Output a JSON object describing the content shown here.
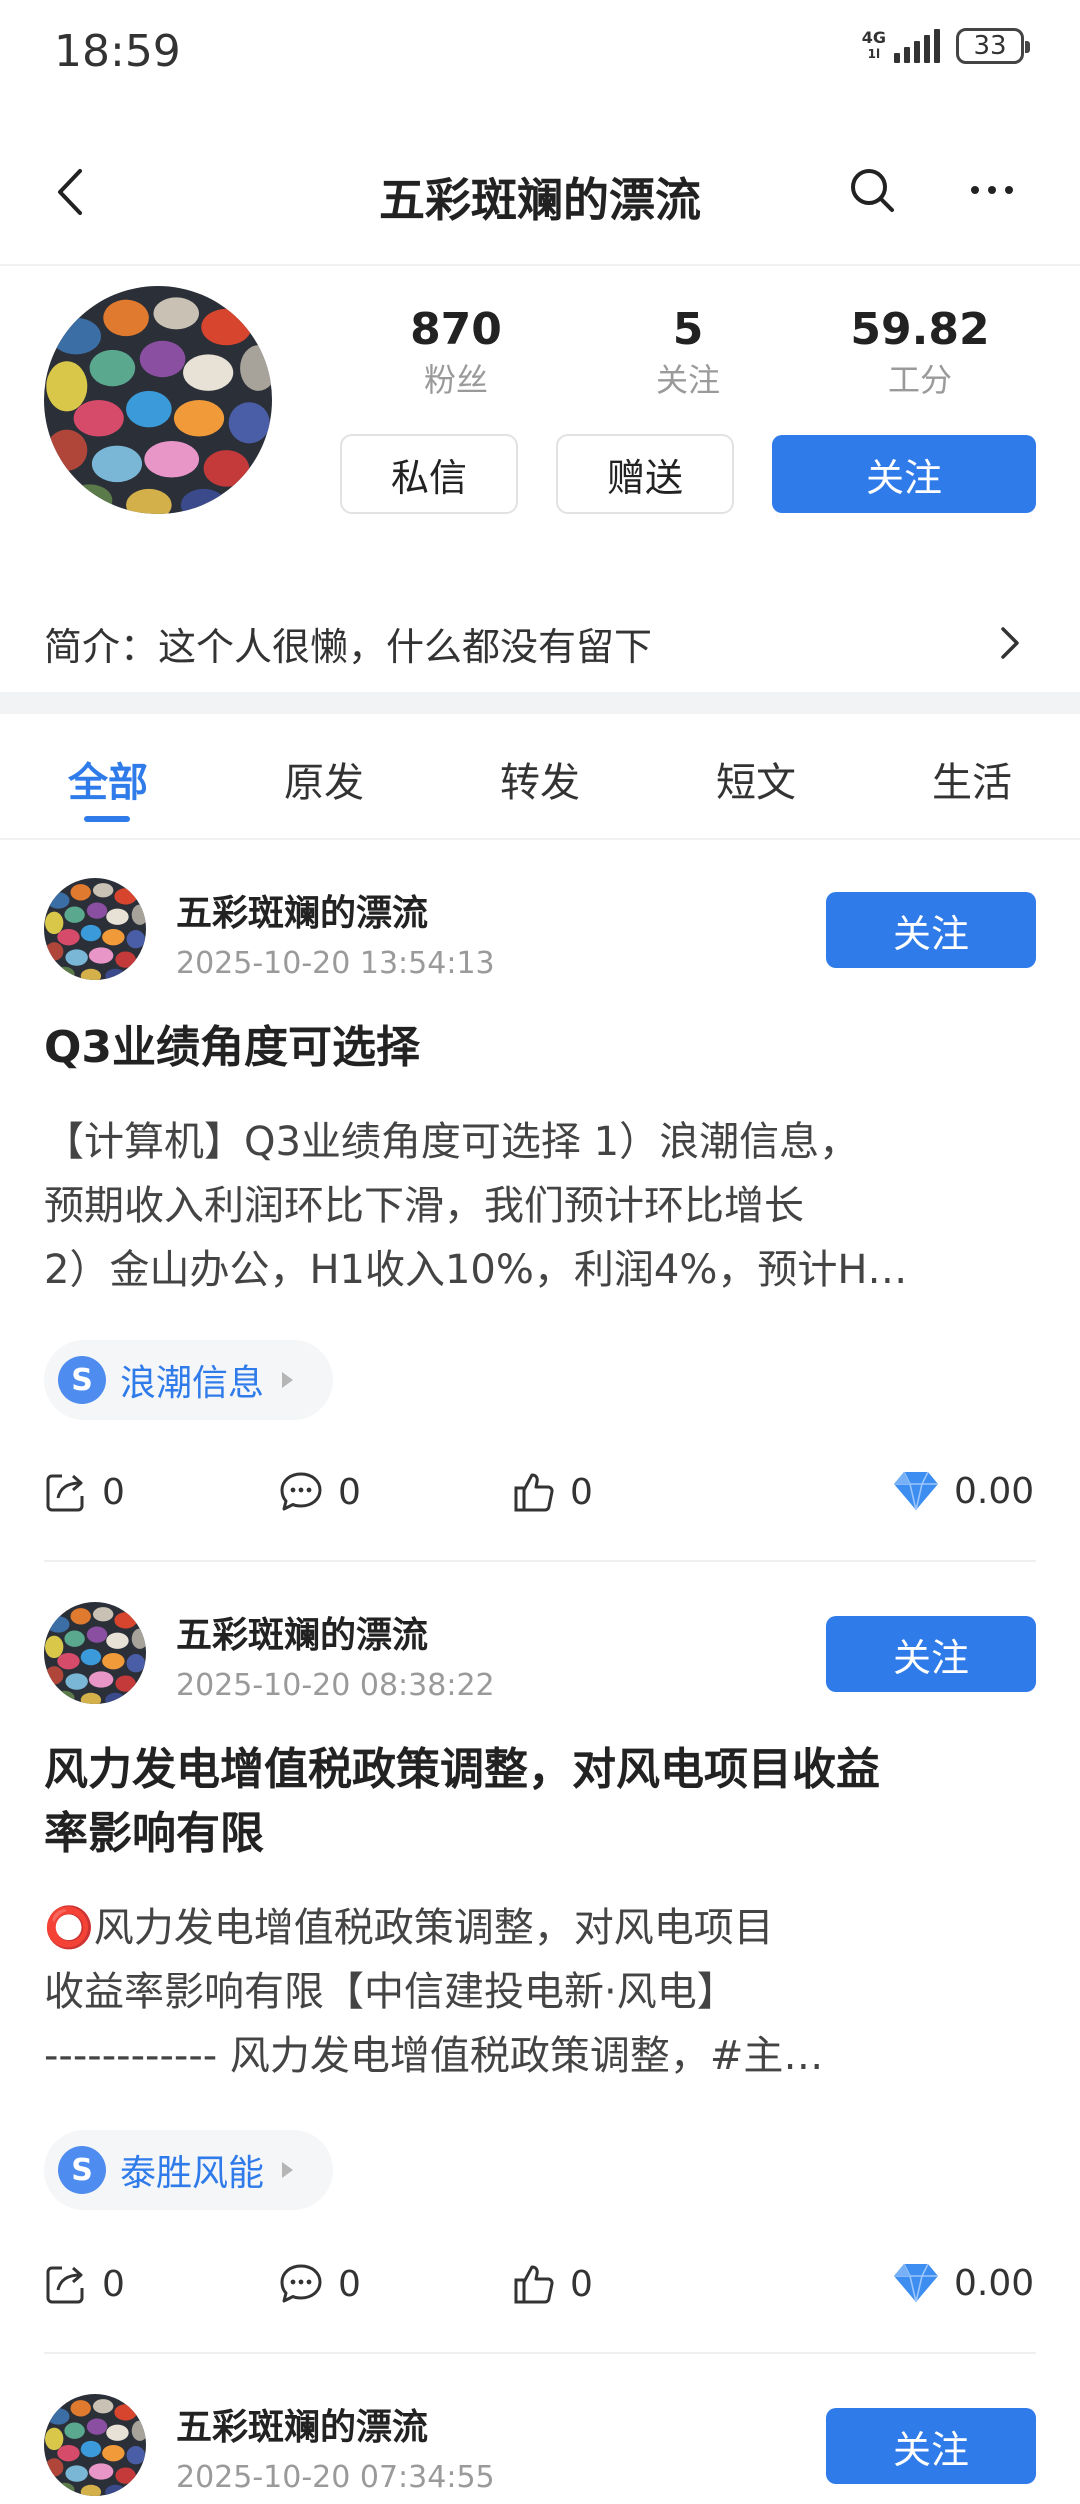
{
  "status_bar": {
    "time": "18:59",
    "network": "4G",
    "network_sub": "1l",
    "battery": "33"
  },
  "nav": {
    "title": "五彩斑斓的漂流"
  },
  "profile": {
    "stats": [
      {
        "value": "870",
        "label": "粉丝"
      },
      {
        "value": "5",
        "label": "关注"
      },
      {
        "value": "59.82",
        "label": "工分"
      }
    ],
    "message_label": "私信",
    "gift_label": "赠送",
    "follow_label": "关注",
    "intro": "简介：这个人很懒，什么都没有留下"
  },
  "tabs": [
    "全部",
    "原发",
    "转发",
    "短文",
    "生活"
  ],
  "active_tab": 0,
  "posts": [
    {
      "author": "五彩斑斓的漂流",
      "time": "2025-10-20 13:54:13",
      "follow_label": "关注",
      "title": "Q3业绩角度可选择",
      "body": [
        "【计算机】Q3业绩角度可选择 1）浪潮信息，",
        "预期收入利润环比下滑，我们预计环比增长",
        "2）金山办公，H1收入10%，利润4%，预计H…"
      ],
      "stock": "浪潮信息",
      "stock_badge": "S",
      "share": "0",
      "comment": "0",
      "like": "0",
      "reward": "0.00"
    },
    {
      "author": "五彩斑斓的漂流",
      "time": "2025-10-20 08:38:22",
      "follow_label": "关注",
      "title_lines": [
        "风力发电增值税政策调整，对风电项目收益",
        "率影响有限"
      ],
      "body": [
        "⭕风力发电增值税政策调整，对风电项目",
        "收益率影响有限【中信建投电新·风电】",
        "------------ 风力发电增值税政策调整，#主…"
      ],
      "stock": "泰胜风能",
      "stock_badge": "S",
      "share": "0",
      "comment": "0",
      "like": "0",
      "reward": "0.00"
    },
    {
      "author": "五彩斑斓的漂流",
      "time": "2025-10-20 07:34:55",
      "follow_label": "关注"
    }
  ],
  "colors": {
    "accent": "#2f7bea",
    "muted": "#9a9a9a",
    "divider": "#f2f3f5"
  }
}
